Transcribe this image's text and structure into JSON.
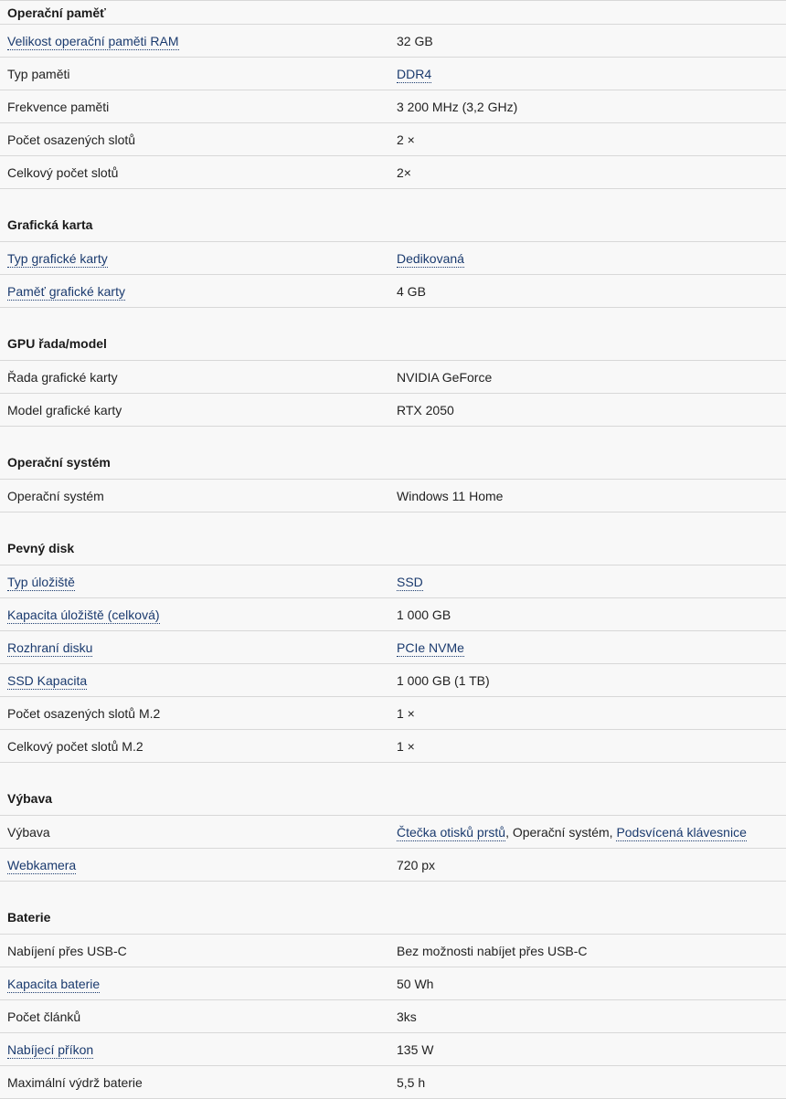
{
  "sections": [
    {
      "title": "Operační paměť",
      "rows": [
        {
          "label": "Velikost operační paměti RAM",
          "label_link": true,
          "value": [
            {
              "text": "32 GB",
              "link": false
            }
          ]
        },
        {
          "label": "Typ paměti",
          "label_link": false,
          "value": [
            {
              "text": "DDR4",
              "link": true
            }
          ]
        },
        {
          "label": "Frekvence paměti",
          "label_link": false,
          "value": [
            {
              "text": "3 200 MHz (3,2 GHz)",
              "link": false
            }
          ]
        },
        {
          "label": "Počet osazených slotů",
          "label_link": false,
          "value": [
            {
              "text": "2 ×",
              "link": false
            }
          ]
        },
        {
          "label": "Celkový počet slotů",
          "label_link": false,
          "value": [
            {
              "text": "2×",
              "link": false
            }
          ]
        }
      ]
    },
    {
      "title": "Grafická karta",
      "rows": [
        {
          "label": "Typ grafické karty",
          "label_link": true,
          "value": [
            {
              "text": "Dedikovaná",
              "link": true
            }
          ]
        },
        {
          "label": "Paměť grafické karty",
          "label_link": true,
          "value": [
            {
              "text": "4 GB",
              "link": false
            }
          ]
        }
      ]
    },
    {
      "title": "GPU řada/model",
      "rows": [
        {
          "label": "Řada grafické karty",
          "label_link": false,
          "value": [
            {
              "text": "NVIDIA GeForce",
              "link": false
            }
          ]
        },
        {
          "label": "Model grafické karty",
          "label_link": false,
          "value": [
            {
              "text": "RTX 2050",
              "link": false
            }
          ]
        }
      ]
    },
    {
      "title": "Operační systém",
      "rows": [
        {
          "label": "Operační systém",
          "label_link": false,
          "value": [
            {
              "text": "Windows 11 Home",
              "link": false
            }
          ]
        }
      ]
    },
    {
      "title": "Pevný disk",
      "rows": [
        {
          "label": "Typ úložiště",
          "label_link": true,
          "value": [
            {
              "text": "SSD",
              "link": true
            }
          ]
        },
        {
          "label": "Kapacita úložiště (celková)",
          "label_link": true,
          "value": [
            {
              "text": "1 000 GB",
              "link": false
            }
          ]
        },
        {
          "label": "Rozhraní disku",
          "label_link": true,
          "value": [
            {
              "text": "PCIe NVMe",
              "link": true
            }
          ]
        },
        {
          "label": "SSD Kapacita",
          "label_link": true,
          "value": [
            {
              "text": "1 000 GB (1 TB)",
              "link": false
            }
          ]
        },
        {
          "label": "Počet osazených slotů M.2",
          "label_link": false,
          "value": [
            {
              "text": "1 ×",
              "link": false
            }
          ]
        },
        {
          "label": "Celkový počet slotů M.2",
          "label_link": false,
          "value": [
            {
              "text": "1 ×",
              "link": false
            }
          ]
        }
      ]
    },
    {
      "title": "Výbava",
      "rows": [
        {
          "label": "Výbava",
          "label_link": false,
          "value": [
            {
              "text": "Čtečka otisků prstů",
              "link": true
            },
            {
              "text": ", Operační systém, ",
              "link": false
            },
            {
              "text": "Podsvícená klávesnice",
              "link": true
            }
          ]
        },
        {
          "label": "Webkamera",
          "label_link": true,
          "value": [
            {
              "text": "720 px",
              "link": false
            }
          ]
        }
      ]
    },
    {
      "title": "Baterie",
      "rows": [
        {
          "label": "Nabíjení přes USB-C",
          "label_link": false,
          "value": [
            {
              "text": "Bez možnosti nabíjet přes USB-C",
              "link": false
            }
          ]
        },
        {
          "label": "Kapacita baterie",
          "label_link": true,
          "value": [
            {
              "text": "50 Wh",
              "link": false
            }
          ]
        },
        {
          "label": "Počet článků",
          "label_link": false,
          "value": [
            {
              "text": "3ks",
              "link": false
            }
          ]
        },
        {
          "label": "Nabíjecí příkon",
          "label_link": true,
          "value": [
            {
              "text": "135 W",
              "link": false
            }
          ]
        },
        {
          "label": "Maximální výdrž baterie",
          "label_link": false,
          "value": [
            {
              "text": "5,5 h",
              "link": false
            }
          ]
        }
      ]
    }
  ]
}
